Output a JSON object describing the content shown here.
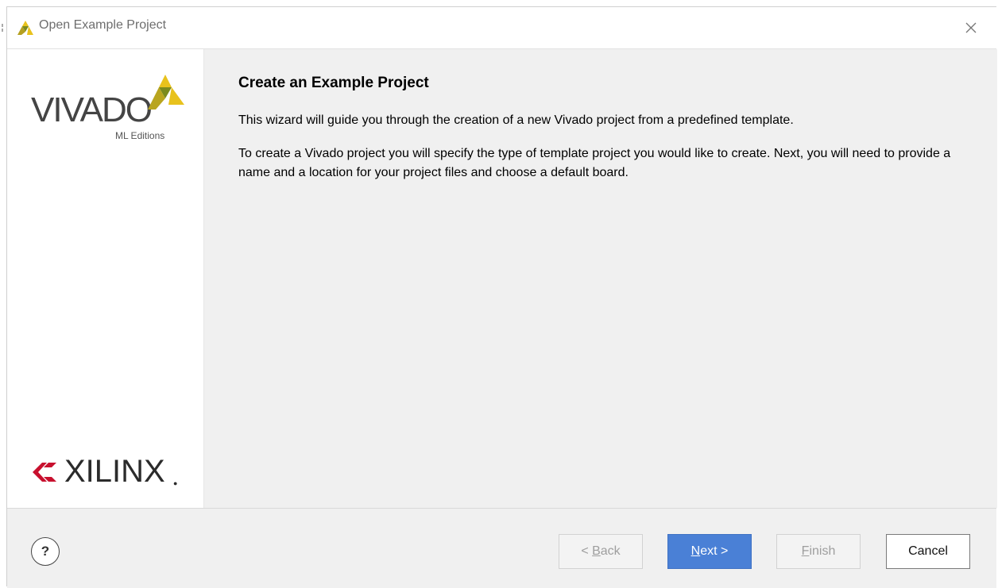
{
  "window": {
    "title": "Open Example Project"
  },
  "sidebar": {
    "vivado_wordmark": "VIVADO",
    "vivado_subtitle": "ML Editions",
    "xilinx_wordmark": "XILINX"
  },
  "content": {
    "heading": "Create an Example Project",
    "paragraph1": "This wizard will guide you through the creation of a new Vivado project from a predefined template.",
    "paragraph2": "To create a Vivado project you will specify the type of template project you would like to create. Next, you will need to provide a name and a location for your project files and choose a default board."
  },
  "footer": {
    "help_label": "?",
    "back": {
      "prefix": "< ",
      "mnemonic": "B",
      "rest": "ack"
    },
    "next": {
      "mnemonic": "N",
      "rest": "ext >"
    },
    "finish": {
      "mnemonic": "F",
      "rest": "inish"
    },
    "cancel_label": "Cancel"
  },
  "icons": {
    "title": "vivado-icon",
    "close": "close-icon",
    "help": "help-icon"
  },
  "colors": {
    "accent_button": "#4a80d6",
    "vivado_yellow": "#e8c21d",
    "vivado_olive": "#7b8a1e",
    "xilinx_red": "#c8102e"
  }
}
